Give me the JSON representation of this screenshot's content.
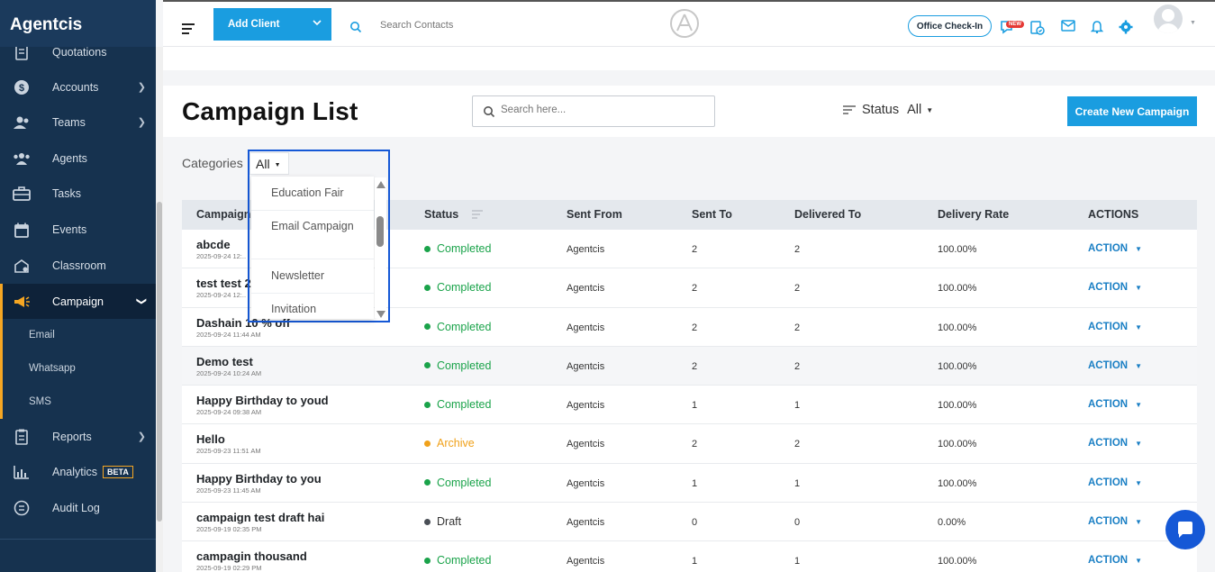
{
  "brand": "Agentcis",
  "sidebar": {
    "items": [
      {
        "label": "Quotations",
        "icon": "document-icon",
        "chevron": false
      },
      {
        "label": "Accounts",
        "icon": "dollar-icon",
        "chevron": true
      },
      {
        "label": "Teams",
        "icon": "team-icon",
        "chevron": true
      },
      {
        "label": "Agents",
        "icon": "agents-icon",
        "chevron": false
      },
      {
        "label": "Tasks",
        "icon": "briefcase-icon",
        "chevron": false
      },
      {
        "label": "Events",
        "icon": "calendar-icon",
        "chevron": false
      },
      {
        "label": "Classroom",
        "icon": "classroom-icon",
        "chevron": false
      },
      {
        "label": "Campaign",
        "icon": "megaphone-icon",
        "chevron": true,
        "active": true
      },
      {
        "label": "Reports",
        "icon": "report-icon",
        "chevron": true
      },
      {
        "label": "Analytics",
        "icon": "analytics-icon",
        "chevron": false,
        "badge": "BETA"
      },
      {
        "label": "Audit Log",
        "icon": "audit-icon",
        "chevron": false
      }
    ],
    "campaign_sub": [
      "Email",
      "Whatsapp",
      "SMS"
    ]
  },
  "topbar": {
    "add_client": "Add Client",
    "search_placeholder": "Search Contacts",
    "office_checkin": "Office Check-In",
    "new_badge": "NEW"
  },
  "page": {
    "title": "Campaign List",
    "search_placeholder": "Search here...",
    "status_label": "Status",
    "status_value": "All",
    "create_button": "Create New Campaign",
    "categories_label": "Categories",
    "categories_value": "All"
  },
  "categories_dropdown": [
    "Education Fair",
    "Email Campaign",
    "Newsletter",
    "Invitation"
  ],
  "table": {
    "headers": [
      "Campaign",
      "Status",
      "Sent From",
      "Sent To",
      "Delivered To",
      "Delivery Rate",
      "ACTIONS"
    ],
    "rows": [
      {
        "name": "abcde",
        "date": "2025-09-24 12:..",
        "status": "Completed",
        "from": "Agentcis",
        "sent": "2",
        "delivered": "2",
        "rate": "100.00%",
        "action": "ACTION"
      },
      {
        "name": "test test 2",
        "date": "2025-09-24 12:..",
        "status": "Completed",
        "from": "Agentcis",
        "sent": "2",
        "delivered": "2",
        "rate": "100.00%",
        "action": "ACTION"
      },
      {
        "name": "Dashain 10 % off",
        "date": "2025-09-24 11:44 AM",
        "status": "Completed",
        "from": "Agentcis",
        "sent": "2",
        "delivered": "2",
        "rate": "100.00%",
        "action": "ACTION"
      },
      {
        "name": "Demo test",
        "date": "2025-09-24 10:24 AM",
        "status": "Completed",
        "from": "Agentcis",
        "sent": "2",
        "delivered": "2",
        "rate": "100.00%",
        "action": "ACTION"
      },
      {
        "name": "Happy Birthday to youd",
        "date": "2025-09-24 09:38 AM",
        "status": "Completed",
        "from": "Agentcis",
        "sent": "1",
        "delivered": "1",
        "rate": "100.00%",
        "action": "ACTION"
      },
      {
        "name": "Hello",
        "date": "2025-09-23 11:51 AM",
        "status": "Archive",
        "from": "Agentcis",
        "sent": "2",
        "delivered": "2",
        "rate": "100.00%",
        "action": "ACTION"
      },
      {
        "name": "Happy Birthday to you",
        "date": "2025-09-23 11:45 AM",
        "status": "Completed",
        "from": "Agentcis",
        "sent": "1",
        "delivered": "1",
        "rate": "100.00%",
        "action": "ACTION"
      },
      {
        "name": "campaign test draft hai",
        "date": "2025-09-19 02:35 PM",
        "status": "Draft",
        "from": "Agentcis",
        "sent": "0",
        "delivered": "0",
        "rate": "0.00%",
        "action": "ACTION"
      },
      {
        "name": "campagin thousand",
        "date": "2025-09-19 02:29 PM",
        "status": "Completed",
        "from": "Agentcis",
        "sent": "1",
        "delivered": "1",
        "rate": "100.00%",
        "action": "ACTION"
      }
    ]
  },
  "colors": {
    "completed": "#1aa34a",
    "archive": "#f0a11a",
    "draft": "#4a4f56",
    "accent": "#1a9de0",
    "sidebar": "#16324f"
  }
}
